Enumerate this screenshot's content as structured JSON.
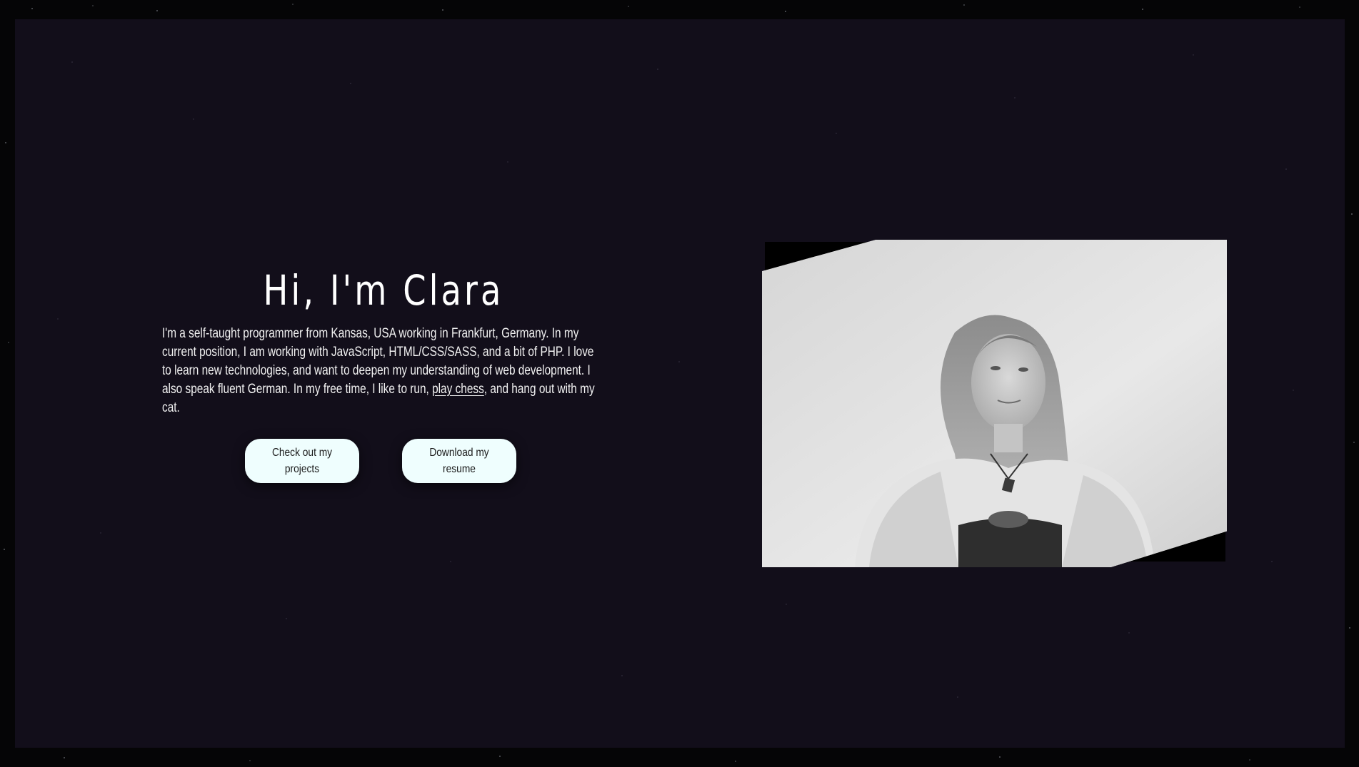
{
  "intro": {
    "title": "Hi, I'm Clara",
    "bio_text": "I'm a self-taught programmer from Kansas, USA working in Frankfurt, Germany. In my current position, I am working with JavaScript, HTML/CSS/SASS, and a bit of PHP. I love to learn new technologies, and want to deepen my understanding of web development. I also speak fluent German. In my free time, I like to run, ",
    "bio_link": "play chess",
    "bio_end": ", and hang out with my cat."
  },
  "buttons": {
    "projects": "Check out my projects",
    "resume": "Download my resume"
  },
  "colors": {
    "page_background": "#050506",
    "panel_background": "#120e1a",
    "button_background": "#effefe",
    "text": "#ffffff"
  }
}
